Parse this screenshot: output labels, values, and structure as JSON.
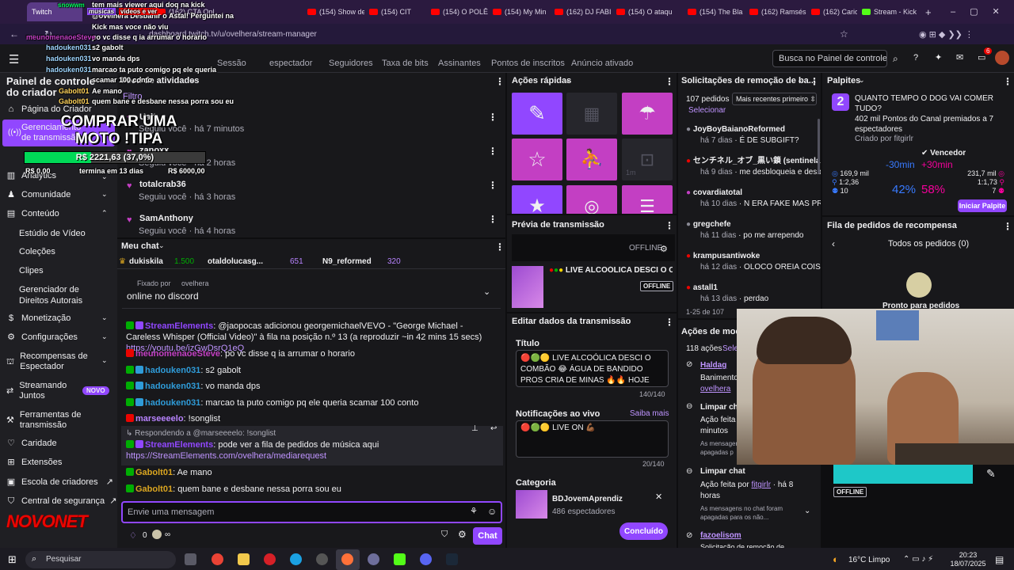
{
  "browser": {
    "tabs": [
      {
        "label": "Twitch",
        "active": true
      },
      {
        "label": "(162) GTA Onl"
      },
      {
        "label": "(154) Show de"
      },
      {
        "label": "(154) CIT"
      },
      {
        "label": "(154) O POLÊ"
      },
      {
        "label": "(154) My Min"
      },
      {
        "label": "(162) DJ FABI"
      },
      {
        "label": "(154) O ataqu"
      },
      {
        "label": "(154) The Bla"
      },
      {
        "label": "(162) Ramsés"
      },
      {
        "label": "(162) Carioca"
      },
      {
        "label": "Stream - Kick"
      }
    ],
    "url": "dashboard.twitch.tv/u/ovelhera/stream-manager"
  },
  "header": {
    "tabs": [
      "Sessão",
      "espectador",
      "Seguidores",
      "Taxa de bits",
      "Assinantes",
      "Pontos de inscritos",
      "Anúncio ativado"
    ],
    "search_placeholder": "Busca no Painel de controle (C",
    "notif_count": "6"
  },
  "sidebar": {
    "title": "Painel de controle do criador",
    "home": "Página do Criador",
    "active": "Gerenciamento de transmissão",
    "items": [
      {
        "label": "Analytics"
      },
      {
        "label": "Comunidade"
      },
      {
        "label": "Conteúdo"
      }
    ],
    "content_sub": [
      "Estúdio de Vídeo",
      "Coleções",
      "Clipes",
      "Gerenciador de Direitos Autorais"
    ],
    "items2": [
      {
        "label": "Monetização"
      },
      {
        "label": "Configurações"
      },
      {
        "label": "Recompensas de Espectador"
      },
      {
        "label": "Streamando Juntos",
        "badge": "NOVO"
      },
      {
        "label": "Ferramentas de transmissão"
      },
      {
        "label": "Caridade"
      },
      {
        "label": "Extensões"
      },
      {
        "label": "Escola de criadores"
      },
      {
        "label": "Central de segurança"
      }
    ]
  },
  "activity": {
    "title": "Feed de atividades",
    "filter": "Filtro",
    "entries": [
      {
        "name": "Ualt",
        "detail": "Seguiu você · há 7 minutos"
      },
      {
        "name": "zanoxx",
        "detail": "Seguiu você · há 2 horas"
      },
      {
        "name": "totalcrab36",
        "detail": "Seguiu você · há 3 horas"
      },
      {
        "name": "SamAnthony",
        "detail": "Seguiu você · há 4 horas"
      }
    ]
  },
  "chat": {
    "title": "Meu chat",
    "top": [
      {
        "name": "dukiskila",
        "count": "1.500"
      },
      {
        "name": "otaldolucasg...",
        "count": "651"
      },
      {
        "name": "N9_reformed",
        "count": "320"
      }
    ],
    "pinned_by_label": "Fixado por",
    "pinned_by_name": "ovelhera",
    "pinned_text": "online no discord",
    "messages": [
      {
        "user": "StreamElements",
        "text": ": @jaopocas adicionou georgemichaelVEVO - \"George Michael - Careless Whisper (Official Video)\" à fila na posição n.º 13 (a reproduzir ~in 42 mins 15 secs) ",
        "link": "https://youtu.be/izGwDsrQ1eQ"
      },
      {
        "user": "meunomenaoeSteve",
        "text": ": po vc disse q ia arrumar o horario"
      },
      {
        "user": "hadouken031",
        "text": ": s2 gabolt"
      },
      {
        "user": "hadouken031",
        "text": ": vo manda dps"
      },
      {
        "user": "hadouken031",
        "text": ": marcao ta puto comigo pq ele queria scamar 100 conto"
      },
      {
        "user": "marseeeelo",
        "text": ": !songlist"
      },
      {
        "reply": "Respondendo a @marseeeelo: !songlist",
        "user": "StreamElements",
        "text": ": pode ver a fila de pedidos de música aqui ",
        "link": "https://StreamElements.com/ovelhera/mediarequest"
      },
      {
        "user": "Gabolt01",
        "text": ": Ae mano"
      },
      {
        "user": "Gabolt01",
        "text": ": quem bane e desbane nessa porra sou eu"
      }
    ],
    "input_placeholder": "Envie uma mensagem",
    "points": "0",
    "send": "Chat"
  },
  "quick_actions": {
    "title": "Ações rápidas",
    "timer": "1m"
  },
  "preview": {
    "title": "Prévia de transmissão",
    "status": "OFFLINE",
    "stream_title": "LIVE ALCOÓLICA DESCI O C",
    "badge": "OFFLINE"
  },
  "edit": {
    "title": "Editar dados da transmissão",
    "title_label": "Título",
    "title_value": "🔴🟢🟡 LIVE ALCOÓLICA DESCI O COMBÃO 😂 ÁGUA DE BANDIDO PROS CRIA DE MINAS 🔥🔥 HOJE VAI",
    "title_count": "140/140",
    "notif_label": "Notificações ao vivo",
    "notif_link": "Saiba mais",
    "notif_value": "🔴🟢🟡 LIVE ON 💪🏾",
    "notif_count": "20/140",
    "category_label": "Categoria",
    "category_name": "BDJovemAprendiz",
    "category_viewers": "486 espectadores",
    "done": "Concluído"
  },
  "removal": {
    "title": "Solicitações de remoção de ba...",
    "count": "107 pedidos",
    "sort": "Mais recentes primeiro",
    "select": "Selecionar",
    "rows": [
      {
        "name": "JoyBoyBaianoReformed",
        "time": "há 7 dias",
        "text": "É DE SUBGIFT?"
      },
      {
        "name": "センチネル_オブ_黒い鎖 (sentinela",
        "time": "há 9 dias",
        "text": "me desbloqueia e desb"
      },
      {
        "name": "covardiatotal",
        "time": "há 10 dias",
        "text": "N ERA FAKE MAS PRO"
      },
      {
        "name": "gregchefe",
        "time": "há 11 dias",
        "text": "po me arrependo"
      },
      {
        "name": "krampusantiwoke",
        "time": "há 12 dias",
        "text": "OLOCO OREIA COISA I"
      },
      {
        "name": "astall1",
        "time": "há 13 dias",
        "text": "perdao"
      }
    ],
    "range": "1-25 de 107"
  },
  "mod_actions": {
    "title": "Ações de moder",
    "count": "118 ações",
    "select": "Sele",
    "entries": [
      {
        "name": "Haldag",
        "l1": "Banimento",
        "l2": "ovelhera"
      },
      {
        "title": "Limpar chat",
        "l1": "Ação feita",
        "l2": "minutos",
        "l3": "As mensagens",
        "l4": "apagadas p"
      },
      {
        "title": "Limpar chat",
        "l1": "Ação feita por",
        "by": "fitgirlr",
        "l2": "· há 8 horas",
        "l3": "As mensagens no chat foram apagadas para os não..."
      },
      {
        "name": "fazoelisom",
        "l1": "Solicitação de remoção de"
      }
    ]
  },
  "predictions": {
    "title": "Palpites",
    "number": "2",
    "question": "QUANTO TEMPO O DOG VAI COMER TUDO?",
    "pts": "402 mil Pontos do Canal premiados a 7 espectadores",
    "created": "Criado por fitgirlr",
    "winner": "Vencedor",
    "left": {
      "label": "-30min",
      "pts": "169,9 mil",
      "ratio": "1:2,36",
      "users": "10",
      "pct": "42%"
    },
    "right": {
      "label": "+30min",
      "pts": "231,7 mil",
      "ratio": "1:1,73",
      "users": "7",
      "pct": "58%"
    },
    "start": "Iniciar Palpite"
  },
  "rewards": {
    "title": "Fila de pedidos de recompensa",
    "filter": "Todos os pedidos (0)",
    "ready": "Pronto para pedidos"
  },
  "overlay": {
    "goal_text": "COMPRAR UMA MOTO !TIPA",
    "goal_amount": "R$ 2221,63 (37,0%)",
    "goal_fraction": 0.37,
    "goal_min": "R$ 0,00",
    "goal_end": "termina em 13 dias",
    "goal_max": "R$ 6000,00",
    "top_lines": [
      "tem mais viewer aqui doq na kick",
      "@ovelhera Desbanir o Astal! Perguntei na",
      "Kick mas voce não viu",
      "po vc disse q ia arrumar o horario",
      "s2 gabolt",
      "vo manda dps",
      "marcao ta puto comigo pq ele queria",
      "scamar 100 conto",
      "Ae mano",
      "quem bane e desbane nessa porra sou eu"
    ],
    "top_users": [
      "snowwm",
      "musicas",
      "videos e ver",
      "meunomenaoeSteve",
      "hadouken031",
      "hadouken031",
      "hadouken031",
      "Gabolt01",
      "Gabolt01"
    ],
    "cam_label": "OFFLINE",
    "logo": "NOVONET"
  },
  "taskbar": {
    "search": "Pesquisar",
    "weather": "16°C  Limpo",
    "time": "20:23",
    "date": "18/07/2025"
  }
}
